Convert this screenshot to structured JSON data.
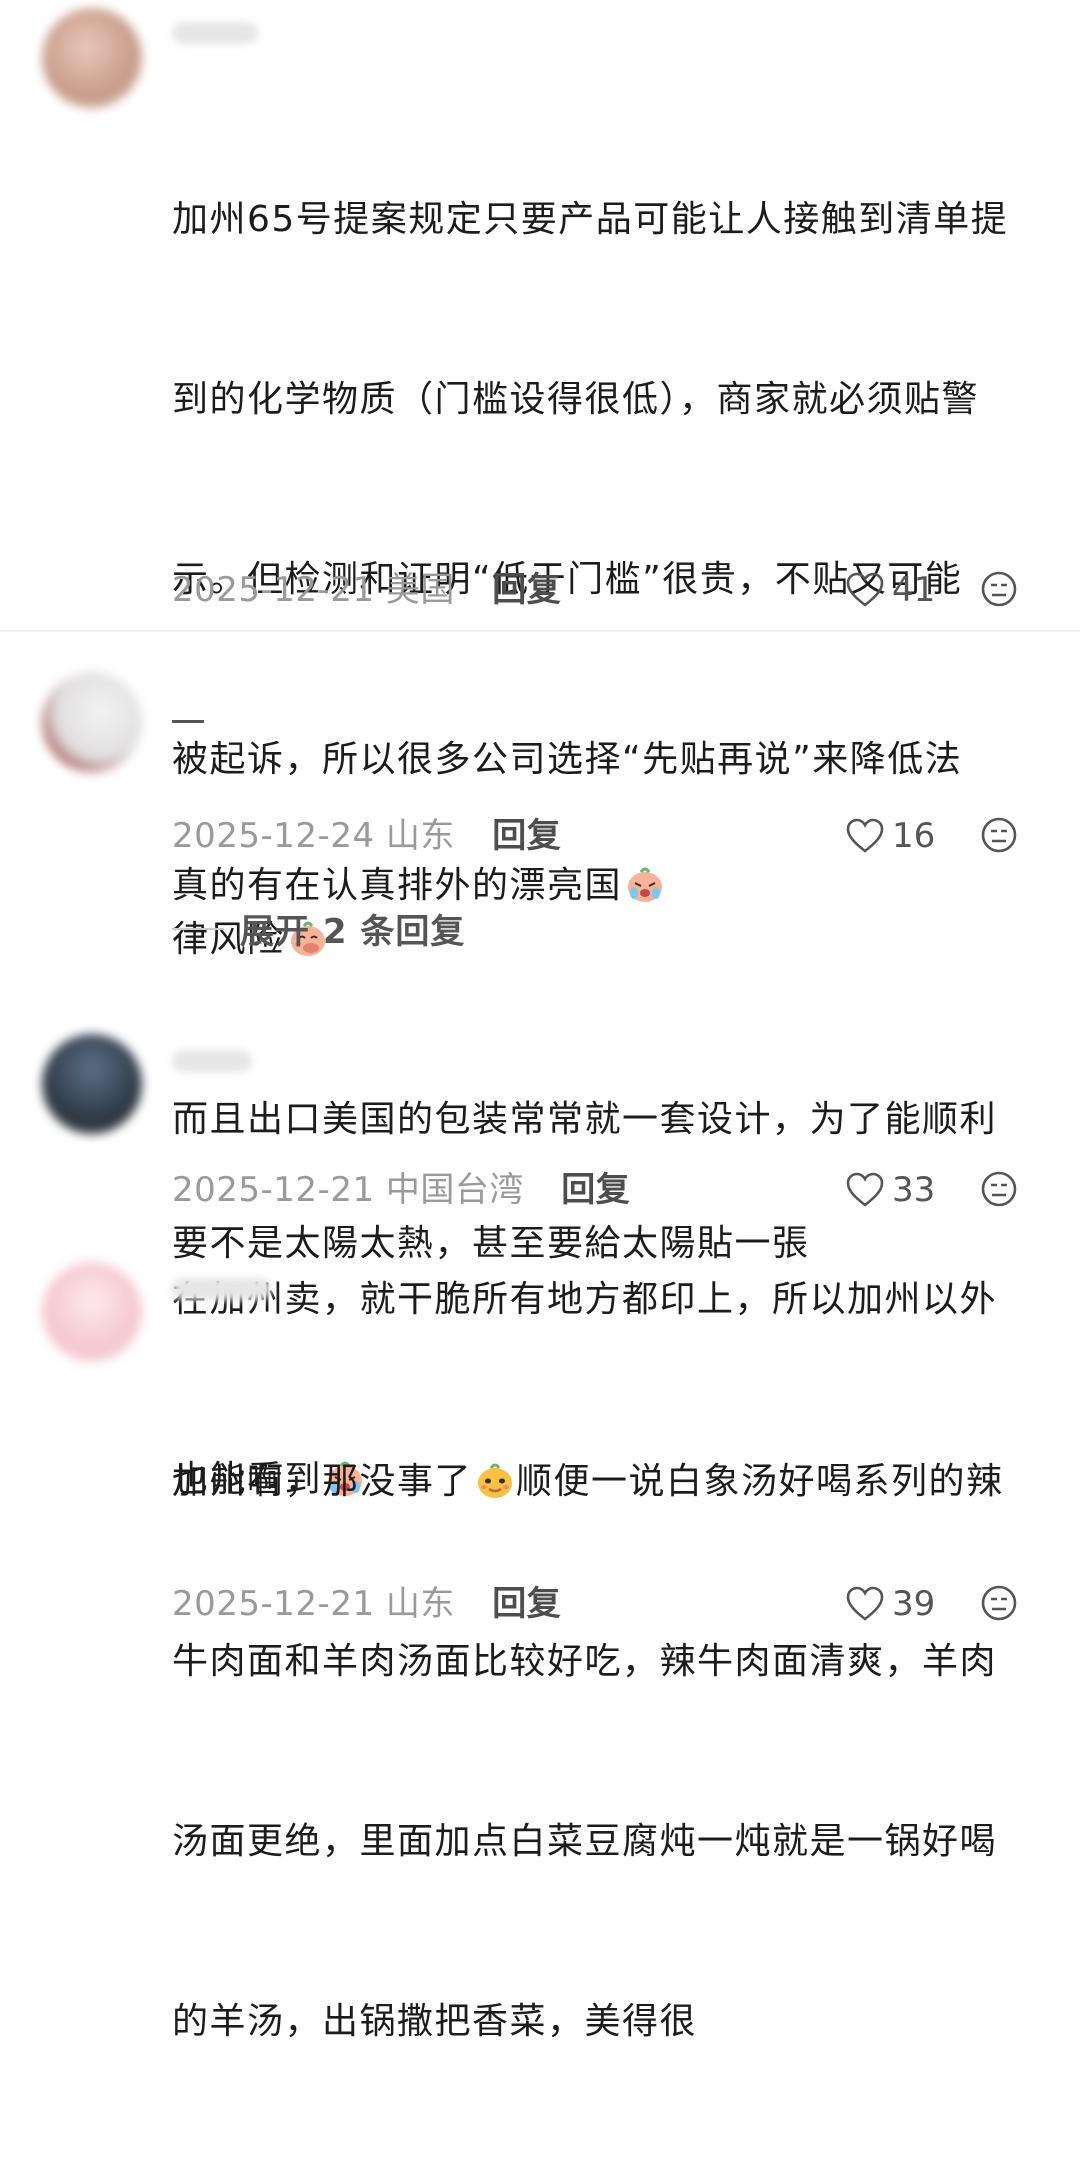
{
  "comments": [
    {
      "body_lines": [
        "加州65号提案规定只要产品可能让人接触到清单提",
        "到的化学物质（门槛设得很低），商家就必须贴警",
        "示。但检测和证明“低于门槛”很贵，不贴又可能",
        "被起诉，所以很多公司选择“先贴再说”来降低法",
        "律风险",
        "而且出口美国的包装常常就一套设计，为了能顺利",
        "在加州卖，就干脆所有地方都印上，所以加州以外",
        "也能看到"
      ],
      "emoji_1": "covering-mouth-emoji",
      "emoji_2": "crying-emoji",
      "date": "2025-12-21",
      "location": "美国",
      "reply_label": "回复",
      "likes": "41"
    },
    {
      "body": "真的有在认真排外的漂亮国",
      "emoji": "crying-emoji",
      "date": "2025-12-24",
      "location": "山东",
      "reply_label": "回复",
      "likes": "16",
      "expand_label": "展开 2 条回复"
    },
    {
      "body": "要不是太陽太熱，甚至要給太陽貼一張",
      "date": "2025-12-21",
      "location": "中国台湾",
      "reply_label": "回复",
      "likes": "33"
    },
    {
      "body_lines": [
        "加州啊，那没事了",
        "顺便一说白象汤好喝系列的辣",
        "牛肉面和羊肉汤面比较好吃，辣牛肉面清爽，羊肉",
        "汤面更绝，里面加点白菜豆腐炖一炖就是一锅好喝",
        "的羊汤，出锅撒把香菜，美得很"
      ],
      "emoji": "smug-face-emoji",
      "date": "2025-12-21",
      "location": "山东",
      "reply_label": "回复",
      "likes": "39"
    }
  ],
  "icons": {
    "like": "heart-outline-icon",
    "dislike": "meh-face-icon"
  },
  "colors": {
    "text": "#1c1c1c",
    "meta": "#9a9a9a",
    "divider": "#eeeeee"
  }
}
